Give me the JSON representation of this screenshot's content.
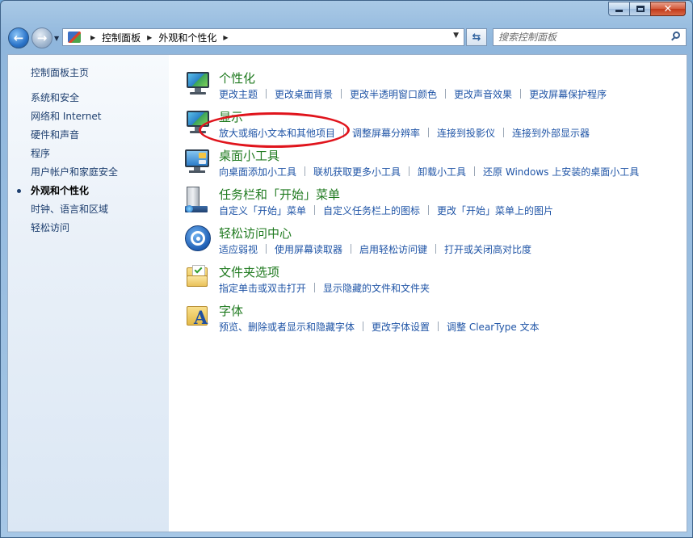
{
  "address_bar": {
    "breadcrumbs": [
      "控制面板",
      "外观和个性化"
    ]
  },
  "search": {
    "placeholder": "搜索控制面板"
  },
  "sidebar": {
    "home": "控制面板主页",
    "items": [
      {
        "label": "系统和安全",
        "active": false
      },
      {
        "label": "网络和 Internet",
        "active": false
      },
      {
        "label": "硬件和声音",
        "active": false
      },
      {
        "label": "程序",
        "active": false
      },
      {
        "label": "用户帐户和家庭安全",
        "active": false
      },
      {
        "label": "外观和个性化",
        "active": true
      },
      {
        "label": "时钟、语言和区域",
        "active": false
      },
      {
        "label": "轻松访问",
        "active": false
      }
    ]
  },
  "categories": [
    {
      "title": "个性化",
      "icon": "personalization-monitor-icon",
      "links": [
        "更改主题",
        "更改桌面背景",
        "更改半透明窗口颜色",
        "更改声音效果",
        "更改屏幕保护程序"
      ]
    },
    {
      "title": "显示",
      "icon": "display-monitor-icon",
      "links": [
        "放大或缩小文本和其他项目",
        "调整屏幕分辨率",
        "连接到投影仪",
        "连接到外部显示器"
      ]
    },
    {
      "title": "桌面小工具",
      "icon": "desktop-gadgets-icon",
      "links": [
        "向桌面添加小工具",
        "联机获取更多小工具",
        "卸载小工具",
        "还原 Windows 上安装的桌面小工具"
      ]
    },
    {
      "title": "任务栏和「开始」菜单",
      "icon": "taskbar-start-menu-icon",
      "links": [
        "自定义「开始」菜单",
        "自定义任务栏上的图标",
        "更改「开始」菜单上的图片"
      ]
    },
    {
      "title": "轻松访问中心",
      "icon": "ease-of-access-icon",
      "links": [
        "适应弱视",
        "使用屏幕读取器",
        "启用轻松访问键",
        "打开或关闭高对比度"
      ]
    },
    {
      "title": "文件夹选项",
      "icon": "folder-options-icon",
      "links": [
        "指定单击或双击打开",
        "显示隐藏的文件和文件夹"
      ]
    },
    {
      "title": "字体",
      "icon": "fonts-folder-icon",
      "links": [
        "预览、删除或者显示和隐藏字体",
        "更改字体设置",
        "调整 ClearType 文本"
      ]
    }
  ],
  "fonts_icon_letter": "A",
  "colors": {
    "category_title": "#1f7a1f",
    "link": "#1f54a6",
    "sidebar_link": "#1e3f6f",
    "annotation": "#e0141c"
  }
}
